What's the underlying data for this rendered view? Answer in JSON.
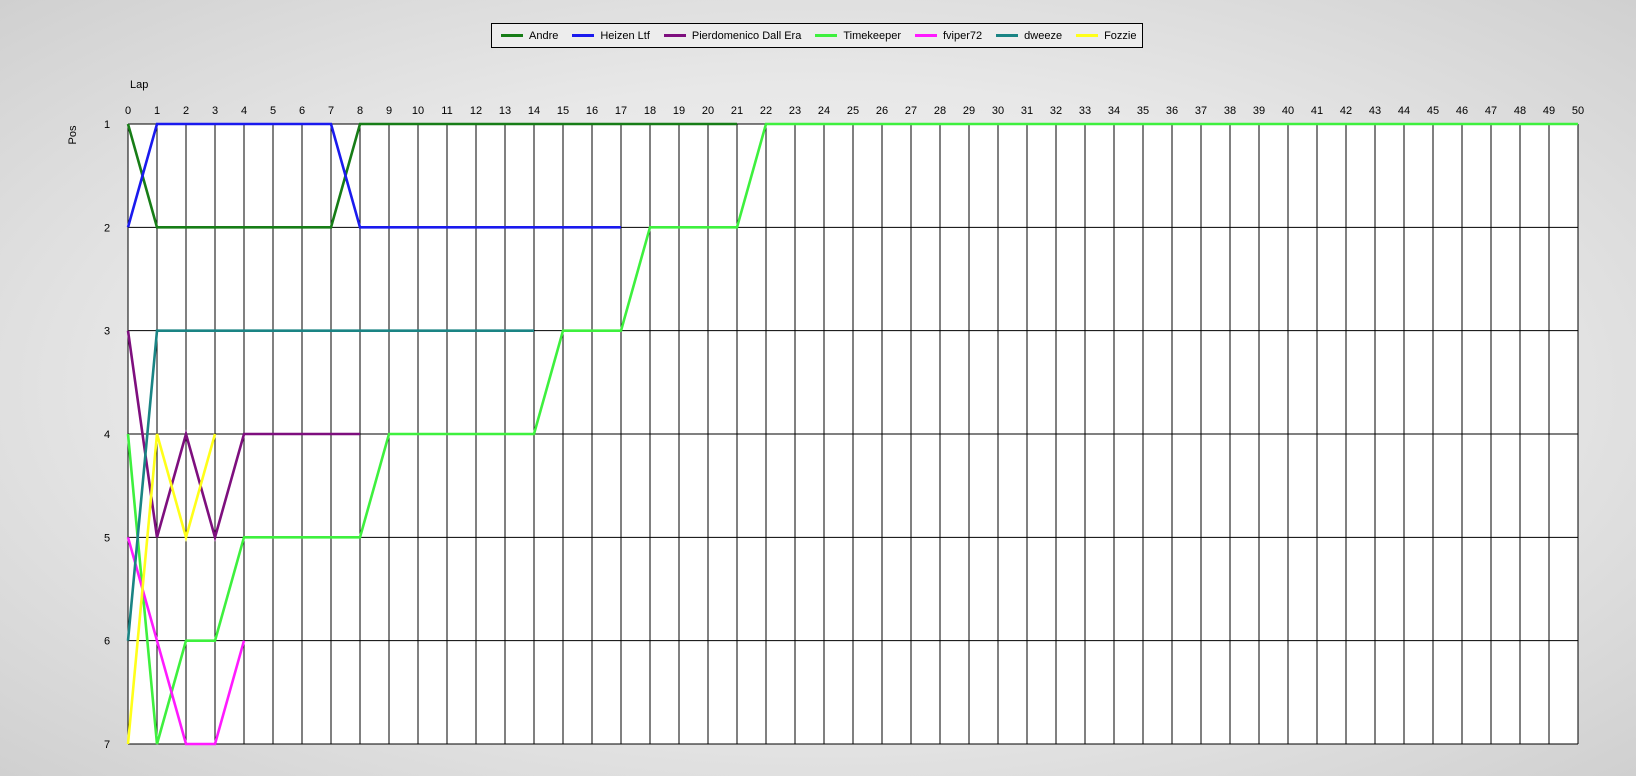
{
  "chart_data": {
    "type": "line",
    "xlabel": "Lap",
    "ylabel": "Pos",
    "xlim": [
      0,
      50
    ],
    "ylim": [
      1,
      7
    ],
    "y_inverted": true,
    "grid": true,
    "legend_position": "top-center",
    "x_ticks": [
      0,
      1,
      2,
      3,
      4,
      5,
      6,
      7,
      8,
      9,
      10,
      11,
      12,
      13,
      14,
      15,
      16,
      17,
      18,
      19,
      20,
      21,
      22,
      23,
      24,
      25,
      26,
      27,
      28,
      29,
      30,
      31,
      32,
      33,
      34,
      35,
      36,
      37,
      38,
      39,
      40,
      41,
      42,
      43,
      44,
      45,
      46,
      47,
      48,
      49,
      50
    ],
    "y_ticks": [
      1,
      2,
      3,
      4,
      5,
      6,
      7
    ],
    "series": [
      {
        "name": "Andre",
        "color": "#177d17",
        "points": [
          [
            0,
            1
          ],
          [
            1,
            2
          ],
          [
            7,
            2
          ],
          [
            8,
            1
          ],
          [
            21,
            1
          ]
        ]
      },
      {
        "name": "Heizen Ltf",
        "color": "#1a1aee",
        "points": [
          [
            0,
            2
          ],
          [
            1,
            1
          ],
          [
            7,
            1
          ],
          [
            8,
            2
          ],
          [
            17,
            2
          ]
        ]
      },
      {
        "name": "Pierdomenico Dall Era",
        "color": "#7e0f7e",
        "points": [
          [
            0,
            3
          ],
          [
            1,
            5
          ],
          [
            2,
            4
          ],
          [
            3,
            5
          ],
          [
            4,
            4
          ],
          [
            8,
            4
          ]
        ]
      },
      {
        "name": "Timekeeper",
        "color": "#3ef03e",
        "points": [
          [
            0,
            4
          ],
          [
            1,
            7
          ],
          [
            2,
            6
          ],
          [
            3,
            6
          ],
          [
            4,
            5
          ],
          [
            8,
            5
          ],
          [
            9,
            4
          ],
          [
            14,
            4
          ],
          [
            15,
            3
          ],
          [
            17,
            3
          ],
          [
            18,
            2
          ],
          [
            21,
            2
          ],
          [
            22,
            1
          ],
          [
            50,
            1
          ]
        ]
      },
      {
        "name": "fviper72",
        "color": "#ff1aff",
        "points": [
          [
            0,
            5
          ],
          [
            1,
            6
          ],
          [
            2,
            7
          ],
          [
            3,
            7
          ],
          [
            4,
            6
          ]
        ]
      },
      {
        "name": "dweeze",
        "color": "#1a8484",
        "points": [
          [
            0,
            6
          ],
          [
            1,
            3
          ],
          [
            14,
            3
          ]
        ]
      },
      {
        "name": "Fozzie",
        "color": "#ffff1a",
        "points": [
          [
            0,
            7
          ],
          [
            1,
            4
          ],
          [
            2,
            5
          ],
          [
            3,
            4
          ]
        ]
      }
    ]
  }
}
